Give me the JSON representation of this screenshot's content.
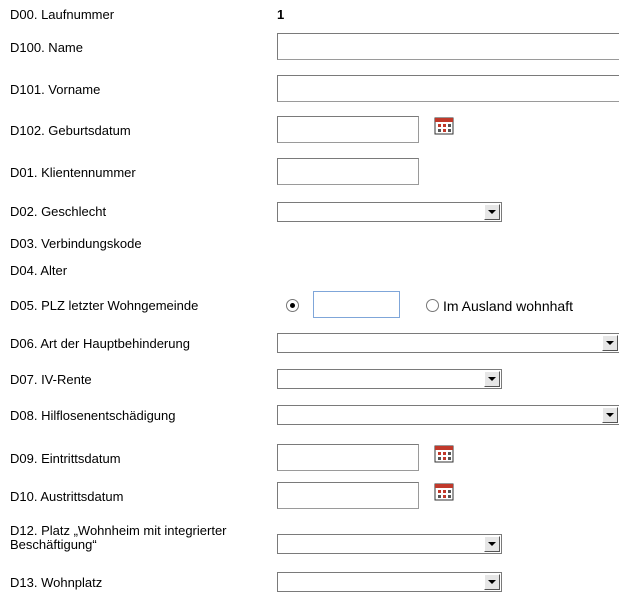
{
  "fields": {
    "d00": {
      "label": "D00. Laufnummer",
      "value": "1"
    },
    "d100": {
      "label": "D100. Name",
      "value": ""
    },
    "d101": {
      "label": "D101. Vorname",
      "value": ""
    },
    "d102": {
      "label": "D102. Geburtsdatum",
      "value": ""
    },
    "d01": {
      "label": "D01. Klientennummer",
      "value": ""
    },
    "d02": {
      "label": "D02. Geschlecht",
      "value": ""
    },
    "d03": {
      "label": "D03. Verbindungskode"
    },
    "d04": {
      "label": "D04. Alter"
    },
    "d05": {
      "label": "D05. PLZ letzter Wohngemeinde",
      "value": "",
      "abroad_label": "Im Ausland wohnhaft",
      "selected": "plz"
    },
    "d06": {
      "label": "D06. Art der Hauptbehinderung",
      "value": ""
    },
    "d07": {
      "label": "D07. IV-Rente",
      "value": ""
    },
    "d08": {
      "label": "D08. Hilflosenentschädigung",
      "value": ""
    },
    "d09": {
      "label": "D09. Eintrittsdatum",
      "value": ""
    },
    "d10": {
      "label": "D10. Austrittsdatum",
      "value": ""
    },
    "d12": {
      "label": "D12. Platz „Wohnheim mit integrierter Beschäftigung“",
      "value": ""
    },
    "d13": {
      "label": "D13. Wohnplatz",
      "value": ""
    }
  },
  "icons": {
    "calendar": "calendar-icon",
    "dropdown": "chevron-down-icon"
  },
  "colors": {
    "calendar_red": "#c0392b",
    "focus_border": "#7fa6d9"
  }
}
